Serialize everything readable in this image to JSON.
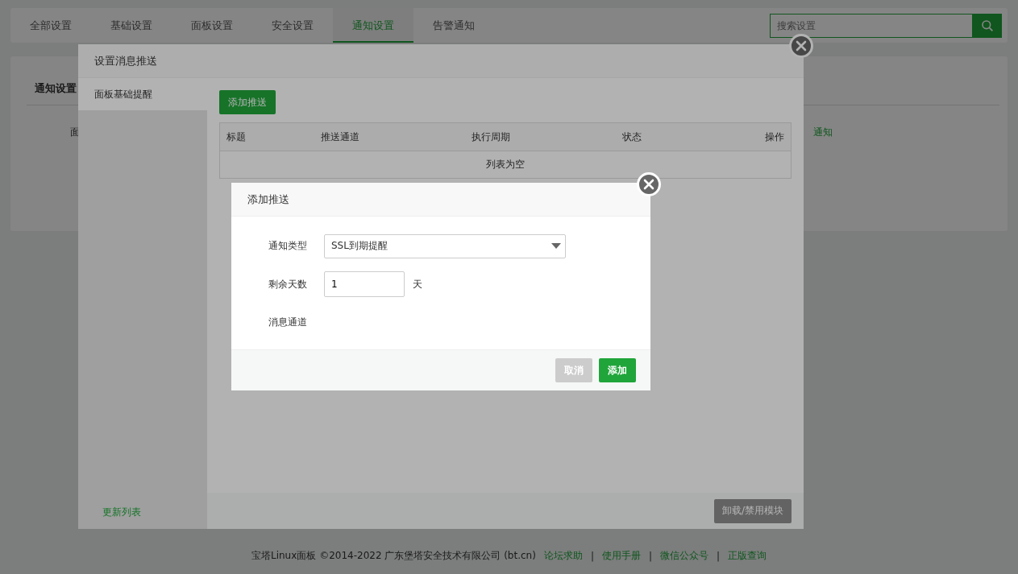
{
  "nav": {
    "tabs": [
      {
        "label": "全部设置",
        "selected": false
      },
      {
        "label": "基础设置",
        "selected": false
      },
      {
        "label": "面板设置",
        "selected": false
      },
      {
        "label": "安全设置",
        "selected": false
      },
      {
        "label": "通知设置",
        "selected": true
      },
      {
        "label": "告警通知",
        "selected": false
      }
    ],
    "search": {
      "placeholder": "搜索设置"
    }
  },
  "page": {
    "section_title": "通知设置",
    "fragment_left": "面",
    "fragment_right": "通知"
  },
  "footer": {
    "copyright": "宝塔Linux面板 ©2014-2022 广东堡塔安全技术有限公司 (bt.cn)",
    "separator": "|",
    "links": [
      "论坛求助",
      "使用手册",
      "微信公众号",
      "正版查询"
    ]
  },
  "dialog": {
    "title": "设置消息推送",
    "sidebar": {
      "items": [
        {
          "label": "面板基础提醒",
          "selected": true
        }
      ],
      "footer_link": "更新列表"
    },
    "add_button": "添加推送",
    "table": {
      "columns": [
        "标题",
        "推送通道",
        "执行周期",
        "状态",
        "操作"
      ],
      "empty_text": "列表为空"
    },
    "footer_button": "卸载/禁用模块"
  },
  "subdialog": {
    "title": "添加推送",
    "fields": [
      {
        "kind": "select",
        "label": "通知类型",
        "value": "SSL到期提醒"
      },
      {
        "kind": "number",
        "label": "剩余天数",
        "value": "1",
        "unit": "天"
      },
      {
        "kind": "empty",
        "label": "消息通道"
      }
    ],
    "buttons": [
      {
        "label": "取消",
        "kind": "cancel"
      },
      {
        "label": "添加",
        "kind": "primary"
      }
    ]
  }
}
